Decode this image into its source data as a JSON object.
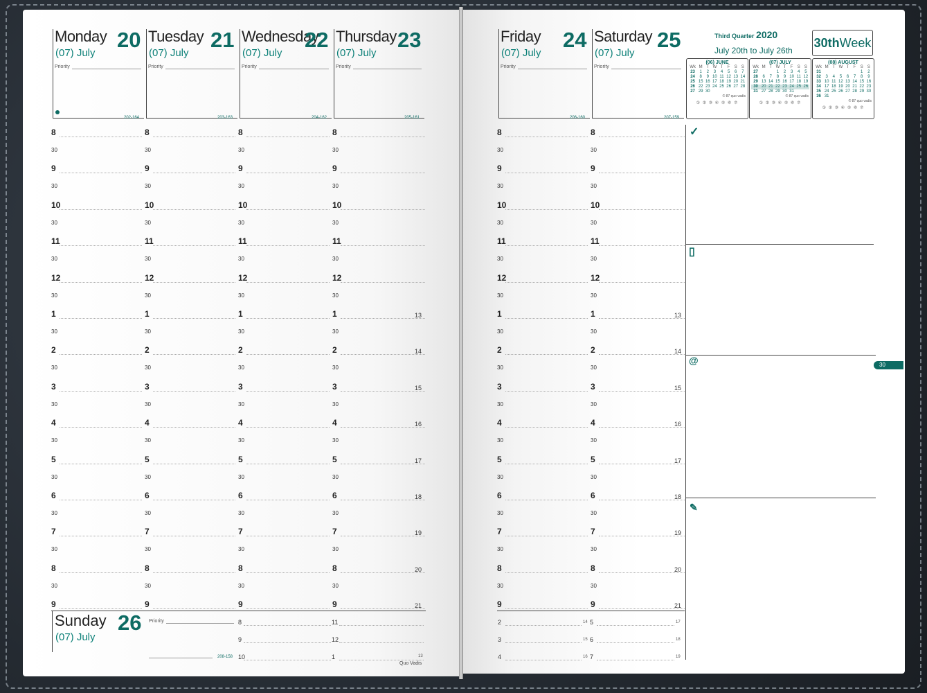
{
  "days": [
    {
      "name": "Monday",
      "num": "20",
      "month": "(07) July",
      "code": "202-164"
    },
    {
      "name": "Tuesday",
      "num": "21",
      "month": "(07) July",
      "code": "203-163"
    },
    {
      "name": "Wednesday",
      "num": "22",
      "month": "(07) July",
      "code": "204-162"
    },
    {
      "name": "Thursday",
      "num": "23",
      "month": "(07) July",
      "code": "205-161"
    },
    {
      "name": "Friday",
      "num": "24",
      "month": "(07) July",
      "code": "206-160"
    },
    {
      "name": "Saturday",
      "num": "25",
      "month": "(07) July",
      "code": "207-159"
    }
  ],
  "priority_label": "Priority",
  "hours": [
    "8",
    "9",
    "10",
    "11",
    "12",
    "1",
    "2",
    "3",
    "4",
    "5",
    "6",
    "7",
    "8",
    "9"
  ],
  "half_label": "30",
  "alt_hours": [
    "13",
    "14",
    "15",
    "16",
    "17",
    "18",
    "19",
    "20",
    "21"
  ],
  "sunday": {
    "name": "Sunday",
    "num": "26",
    "month": "(07) July",
    "code": "208-158",
    "hours_a": [
      "8",
      "9",
      "10"
    ],
    "hours_b": [
      "11",
      "12",
      "1"
    ],
    "end": "13"
  },
  "saturday_extra": {
    "a": [
      "2",
      "3",
      "4"
    ],
    "a_alt": [
      "14",
      "15",
      "16"
    ],
    "b": [
      "5",
      "6",
      "7"
    ],
    "b_alt": [
      "17",
      "18",
      "19"
    ]
  },
  "quarter": {
    "label": "Third Quarter",
    "year": "2020",
    "range": "July 20th to July 26th"
  },
  "week": {
    "num": "30th",
    "label": "Week"
  },
  "minicals": [
    {
      "title": "(06) JUNE",
      "head": [
        "Wk",
        "M",
        "T",
        "W",
        "T",
        "F",
        "S",
        "S"
      ],
      "rows": [
        [
          "23",
          "1",
          "2",
          "3",
          "4",
          "5",
          "6",
          "7"
        ],
        [
          "24",
          "8",
          "9",
          "10",
          "11",
          "12",
          "13",
          "14"
        ],
        [
          "25",
          "15",
          "16",
          "17",
          "18",
          "19",
          "20",
          "21"
        ],
        [
          "26",
          "22",
          "23",
          "24",
          "25",
          "26",
          "27",
          "28"
        ],
        [
          "27",
          "29",
          "30",
          "",
          "",
          "",
          "",
          ""
        ]
      ]
    },
    {
      "title": "(07) JULY",
      "head": [
        "Wk",
        "M",
        "T",
        "W",
        "T",
        "F",
        "S",
        "S"
      ],
      "rows": [
        [
          "27",
          "",
          "",
          "1",
          "2",
          "3",
          "4",
          "5"
        ],
        [
          "28",
          "6",
          "7",
          "8",
          "9",
          "10",
          "11",
          "12"
        ],
        [
          "29",
          "13",
          "14",
          "15",
          "16",
          "17",
          "18",
          "19"
        ],
        [
          "30",
          "20",
          "21",
          "22",
          "23",
          "24",
          "25",
          "26"
        ],
        [
          "31",
          "27",
          "28",
          "29",
          "30",
          "31",
          "",
          ""
        ]
      ]
    },
    {
      "title": "(08) AUGUST",
      "head": [
        "Wk",
        "M",
        "T",
        "W",
        "T",
        "F",
        "S",
        "S"
      ],
      "rows": [
        [
          "31",
          "",
          "",
          "",
          "",
          "",
          "1",
          "2"
        ],
        [
          "32",
          "3",
          "4",
          "5",
          "6",
          "7",
          "8",
          "9"
        ],
        [
          "33",
          "10",
          "11",
          "12",
          "13",
          "14",
          "15",
          "16"
        ],
        [
          "34",
          "17",
          "18",
          "19",
          "20",
          "21",
          "22",
          "23"
        ],
        [
          "35",
          "24",
          "25",
          "26",
          "27",
          "28",
          "29",
          "30"
        ],
        [
          "36",
          "31",
          "",
          "",
          "",
          "",
          "",
          ""
        ]
      ]
    }
  ],
  "minical_credit": "© 87 quo vadis",
  "circles": "① ② ③ ④ ⑤ ⑥ ⑦",
  "tab_label": "30",
  "brand": "Quo Vadis",
  "icons": {
    "check": "✓",
    "phone": "▯",
    "at": "@",
    "pen": "✎"
  }
}
